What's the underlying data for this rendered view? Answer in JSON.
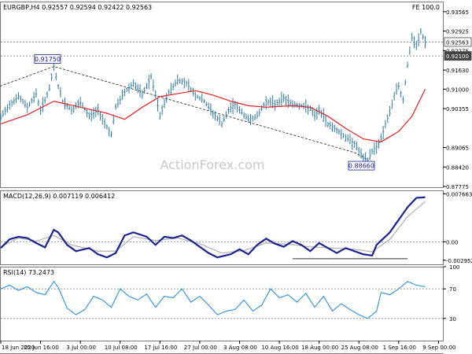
{
  "chart_data": [
    {
      "id": "price",
      "type": "ohlc",
      "title": "EURGBP,H4  0.92557 0.92594 0.92422 0.92563",
      "fe_label": "FE 100.0",
      "watermark": "ActionForex.com",
      "ylim": [
        0.8775,
        0.939
      ],
      "y_ticks": [
        "0.93565",
        "0.92925",
        "0.92275",
        "0.91630",
        "0.91000",
        "0.90355",
        "0.89065",
        "0.88420",
        "0.87775"
      ],
      "x_range": [
        0,
        100
      ],
      "price_series": [
        [
          0,
          0.9005
        ],
        [
          2,
          0.905
        ],
        [
          4,
          0.9075
        ],
        [
          6,
          0.904
        ],
        [
          8,
          0.9085
        ],
        [
          9,
          0.903
        ],
        [
          11,
          0.91
        ],
        [
          12,
          0.9175
        ],
        [
          13,
          0.911
        ],
        [
          14,
          0.906
        ],
        [
          16,
          0.903
        ],
        [
          18,
          0.9055
        ],
        [
          20,
          0.901
        ],
        [
          22,
          0.903
        ],
        [
          24,
          0.8975
        ],
        [
          25,
          0.895
        ],
        [
          26,
          0.904
        ],
        [
          28,
          0.909
        ],
        [
          30,
          0.912
        ],
        [
          32,
          0.908
        ],
        [
          34,
          0.914
        ],
        [
          35,
          0.908
        ],
        [
          36,
          0.901
        ],
        [
          38,
          0.909
        ],
        [
          40,
          0.913
        ],
        [
          42,
          0.912
        ],
        [
          44,
          0.908
        ],
        [
          46,
          0.906
        ],
        [
          48,
          0.902
        ],
        [
          50,
          0.8985
        ],
        [
          52,
          0.904
        ],
        [
          53,
          0.905
        ],
        [
          54,
          0.903
        ],
        [
          56,
          0.9
        ],
        [
          58,
          0.901
        ],
        [
          60,
          0.906
        ],
        [
          62,
          0.905
        ],
        [
          64,
          0.907
        ],
        [
          66,
          0.905
        ],
        [
          68,
          0.9045
        ],
        [
          70,
          0.9035
        ],
        [
          71,
          0.901
        ],
        [
          72,
          0.903
        ],
        [
          74,
          0.8985
        ],
        [
          76,
          0.8965
        ],
        [
          78,
          0.894
        ],
        [
          80,
          0.892
        ],
        [
          81,
          0.8895
        ],
        [
          82,
          0.887
        ],
        [
          83,
          0.8866
        ],
        [
          84,
          0.8895
        ],
        [
          85,
          0.891
        ],
        [
          86,
          0.8935
        ],
        [
          87,
          0.8985
        ],
        [
          88,
          0.902
        ],
        [
          89,
          0.908
        ],
        [
          90,
          0.911
        ],
        [
          91,
          0.9065
        ],
        [
          92,
          0.918
        ],
        [
          93,
          0.927
        ],
        [
          94,
          0.924
        ],
        [
          95,
          0.929
        ],
        [
          96,
          0.9256
        ]
      ],
      "moving_average": [
        [
          0,
          0.8985
        ],
        [
          6,
          0.9015
        ],
        [
          12,
          0.906
        ],
        [
          18,
          0.904
        ],
        [
          24,
          0.902
        ],
        [
          28,
          0.9
        ],
        [
          32,
          0.904
        ],
        [
          36,
          0.9075
        ],
        [
          40,
          0.9085
        ],
        [
          44,
          0.9095
        ],
        [
          48,
          0.908
        ],
        [
          52,
          0.906
        ],
        [
          56,
          0.9045
        ],
        [
          60,
          0.904
        ],
        [
          66,
          0.9045
        ],
        [
          70,
          0.904
        ],
        [
          74,
          0.901
        ],
        [
          78,
          0.897
        ],
        [
          82,
          0.8935
        ],
        [
          86,
          0.8925
        ],
        [
          90,
          0.896
        ],
        [
          93,
          0.901
        ],
        [
          96,
          0.91
        ]
      ],
      "trendline_top": [
        [
          -1,
          0.9105
        ],
        [
          12,
          0.9175
        ],
        [
          80,
          0.889
        ],
        [
          83,
          0.8866
        ]
      ],
      "current_price_line": 0.9256,
      "support_line": 0.921,
      "labels": [
        {
          "text": "0.91750",
          "x": 12,
          "y": 0.9175
        },
        {
          "text": "0.88660",
          "x": 83,
          "y": 0.8866
        },
        {
          "text": "0.92563",
          "y": 0.9256
        },
        {
          "text": "0.92100",
          "y": 0.921
        }
      ],
      "colors": {
        "price": "#2f7aa5",
        "ma": "#e42021",
        "grid": "#9a9a9a"
      }
    },
    {
      "id": "macd",
      "type": "line",
      "title": "MACD(12,26,9) 0.007119 0.006412",
      "ylim": [
        -0.0036,
        0.0082
      ],
      "y_ticks": [
        "0.007663",
        "0.00",
        "-0.002952"
      ],
      "series": [
        {
          "values": [
            [
              0,
              -0.001
            ],
            [
              2,
              0.0004
            ],
            [
              4,
              0.0008
            ],
            [
              6,
              0.0006
            ],
            [
              8,
              -0.0002
            ],
            [
              10,
              -0.0009
            ],
            [
              12,
              0.0019
            ],
            [
              13,
              0.0015
            ],
            [
              15,
              -0.0005
            ],
            [
              17,
              -0.0015
            ],
            [
              20,
              -0.001
            ],
            [
              22,
              -0.002
            ],
            [
              24,
              -0.0025
            ],
            [
              26,
              -0.0018
            ],
            [
              28,
              0.001
            ],
            [
              30,
              0.0015
            ],
            [
              33,
              0.0008
            ],
            [
              35,
              -0.0005
            ],
            [
              37,
              0.0008
            ],
            [
              39,
              0.0006
            ],
            [
              41,
              0.001
            ],
            [
              43,
              0.0002
            ],
            [
              45,
              -0.0008
            ],
            [
              47,
              -0.0018
            ],
            [
              49,
              -0.0025
            ],
            [
              52,
              -0.002
            ],
            [
              54,
              -0.0012
            ],
            [
              56,
              -0.002
            ],
            [
              58,
              -0.0005
            ],
            [
              60,
              0.0005
            ],
            [
              62,
              -0.0003
            ],
            [
              64,
              -0.0008
            ],
            [
              66,
              0.0001
            ],
            [
              68,
              -0.0005
            ],
            [
              70,
              -0.0015
            ],
            [
              72,
              -0.0002
            ],
            [
              74,
              -0.001
            ],
            [
              76,
              -0.0018
            ],
            [
              78,
              -0.001
            ],
            [
              80,
              -0.0015
            ],
            [
              82,
              -0.002
            ],
            [
              84,
              -0.0022
            ],
            [
              85,
              -0.0005
            ],
            [
              88,
              0.0015
            ],
            [
              90,
              0.0035
            ],
            [
              92,
              0.0055
            ],
            [
              94,
              0.007
            ],
            [
              96,
              0.0071
            ]
          ],
          "color": "#1a238f"
        },
        {
          "values": [
            [
              0,
              -0.0008
            ],
            [
              4,
              0.0006
            ],
            [
              8,
              0.0001
            ],
            [
              12,
              0.001
            ],
            [
              16,
              -0.0005
            ],
            [
              22,
              -0.0015
            ],
            [
              26,
              -0.0015
            ],
            [
              30,
              0.0008
            ],
            [
              35,
              0.0002
            ],
            [
              40,
              0.0006
            ],
            [
              45,
              -0.0003
            ],
            [
              50,
              -0.0018
            ],
            [
              55,
              -0.0014
            ],
            [
              60,
              -0.0002
            ],
            [
              65,
              -0.0004
            ],
            [
              70,
              -0.0008
            ],
            [
              75,
              -0.001
            ],
            [
              80,
              -0.0012
            ],
            [
              84,
              -0.0016
            ],
            [
              88,
              0.0004
            ],
            [
              92,
              0.004
            ],
            [
              96,
              0.0064
            ]
          ],
          "color": "#b0b0b0"
        }
      ],
      "baseline": {
        "y": -0.0027,
        "x": [
          66,
          92
        ]
      }
    },
    {
      "id": "rsi",
      "type": "line",
      "title": "RSI(14) 73.2473",
      "ylim": [
        0,
        100
      ],
      "y_ticks": [
        "100",
        "70",
        "30",
        "0"
      ],
      "series": [
        {
          "values": [
            [
              0,
              70
            ],
            [
              2,
              75
            ],
            [
              4,
              68
            ],
            [
              6,
              73
            ],
            [
              8,
              65
            ],
            [
              10,
              62
            ],
            [
              12,
              80
            ],
            [
              13,
              72
            ],
            [
              15,
              44
            ],
            [
              17,
              35
            ],
            [
              19,
              42
            ],
            [
              21,
              60
            ],
            [
              23,
              55
            ],
            [
              25,
              45
            ],
            [
              27,
              70
            ],
            [
              29,
              60
            ],
            [
              31,
              55
            ],
            [
              33,
              63
            ],
            [
              35,
              45
            ],
            [
              37,
              60
            ],
            [
              39,
              58
            ],
            [
              41,
              70
            ],
            [
              43,
              52
            ],
            [
              45,
              60
            ],
            [
              47,
              48
            ],
            [
              49,
              35
            ],
            [
              51,
              40
            ],
            [
              53,
              42
            ],
            [
              55,
              55
            ],
            [
              57,
              40
            ],
            [
              59,
              48
            ],
            [
              61,
              70
            ],
            [
              63,
              58
            ],
            [
              65,
              62
            ],
            [
              67,
              52
            ],
            [
              69,
              64
            ],
            [
              71,
              45
            ],
            [
              73,
              60
            ],
            [
              75,
              40
            ],
            [
              77,
              50
            ],
            [
              79,
              42
            ],
            [
              81,
              35
            ],
            [
              83,
              30
            ],
            [
              85,
              40
            ],
            [
              86,
              65
            ],
            [
              88,
              62
            ],
            [
              90,
              70
            ],
            [
              92,
              80
            ],
            [
              94,
              75
            ],
            [
              96,
              73
            ]
          ],
          "color": "#2e8fe0"
        }
      ],
      "dashed_levels": [
        70,
        30
      ]
    }
  ],
  "x_axis": {
    "labels": [
      "18 Jun 2020",
      "25 Jun 16:00",
      "3 Jul 00:00",
      "10 Jul 08:00",
      "17 Jul 16:00",
      "27 Jul 00:00",
      "3 Aug 08:00",
      "10 Aug 16:00",
      "18 Aug 00:00",
      "25 Aug 08:00",
      "1 Sep 16:00",
      "9 Sep 00:00"
    ],
    "positions": [
      0,
      9,
      18,
      27,
      36,
      45,
      54,
      63,
      72,
      81,
      90,
      99
    ]
  }
}
